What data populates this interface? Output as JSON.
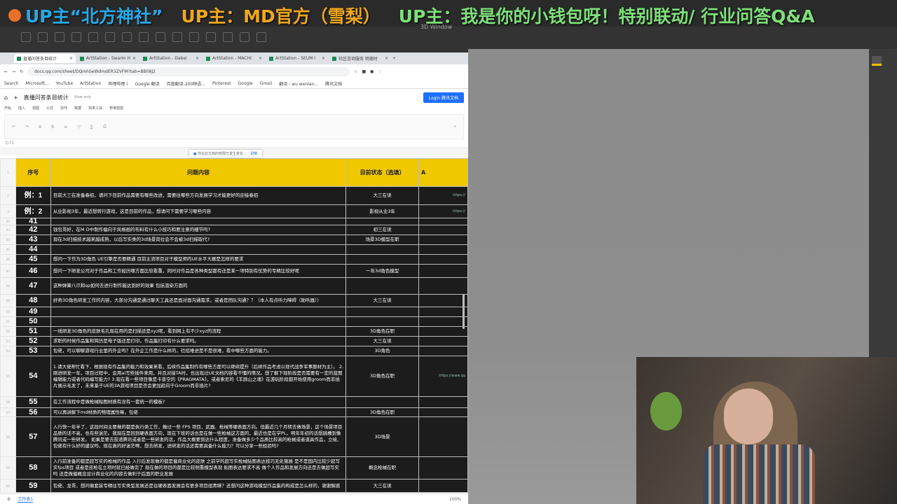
{
  "banner": {
    "part1": "UP主“北方神社”",
    "part2": "UP主：MD官方（雪梨）",
    "part3": "UP主：我是你的小钱包呀！特别联动/ 行业问答Q&A"
  },
  "app": {
    "window_label": "3D Window"
  },
  "browser": {
    "tabs": [
      "直播问答条目统计",
      "ArtStation - Swarm H",
      "ArtStation - Dabei",
      "ArtStation - MACHI",
      "ArtStation - SEUM I",
      "社区咨询服务 明德时"
    ],
    "url": "docs.qq.com/sheet/DQmhSeWdmdER3ZVFM?tab=BB08J2",
    "bookmarks": [
      "Search",
      "Microsoft...",
      "YouTube",
      "ArtStation",
      "哔哩哔哩 (",
      "Google 翻译",
      "百度翻译-200种语...",
      "Pinterest",
      "Google",
      "Gmail",
      "翻译 - wu wenlan...",
      "腾讯文档"
    ]
  },
  "doc": {
    "title": "直播问答条目统计",
    "view_only": "View only",
    "login": "Login 腾讯文档",
    "menu": [
      "开始",
      "插入",
      "视图",
      "公式",
      "协作",
      "数据",
      "效率工具",
      "表格智能"
    ],
    "notice": "你在此文档的权限已发生变化...",
    "notice_action": "刷新",
    "cell_ref": "D71",
    "sheet_tab": "工作表1",
    "zoom": "100%"
  },
  "table": {
    "headers": [
      "序号",
      "问题内容",
      "目前状态（选填）",
      "A"
    ],
    "rows": [
      {
        "rn": "2",
        "no": "例：1",
        "q": "目前大三在准备春招，请问下目前作品需要有哪些改进，需要往哪些方向发展学习才能更好的迎接春招",
        "s": "大三在读",
        "l": "https://"
      },
      {
        "rn": "3",
        "no": "例：2",
        "q": "从业影视3年，最近想转行游戏，这是目前的作品，想请问下需要学习哪些内容",
        "s": "影视从业3年",
        "l": "https://"
      },
      {
        "rn": "42",
        "no": "41",
        "q": "",
        "s": "",
        "l": ""
      },
      {
        "rn": "43",
        "no": "42",
        "q": "钱包哥好，在M D中制作偏向于风格画的布料有什么小技巧和要注意的细节吗?",
        "s": "初三在读",
        "l": ""
      },
      {
        "rn": "44",
        "no": "43",
        "q": "现在3d扫描技术越来越成熟，以后写实类的3d场景岗位会不会被3d扫描取代?",
        "s": "场景3D模型在职",
        "l": ""
      },
      {
        "rn": "45",
        "no": "44",
        "q": "",
        "s": "",
        "l": ""
      },
      {
        "rn": "46",
        "no": "45",
        "q": "想问一下作为3D角色 UE引擎是否要精通 目前主流项目对于模型师的UE水平大概是怎样的要求",
        "s": "",
        "l": ""
      },
      {
        "rn": "47",
        "no": "46",
        "q": "想问一下研发公司对于作品和工作经历哪方面比较看重，同时对作品是各种类型都有还是某一项特别有优势的专精比较好呢",
        "s": "一年3d角色模型",
        "l": ""
      },
      {
        "rn": "48",
        "no": "47",
        "q": "这种弹簧八爪和sp如何去进行制作能达到好的效果 包括渲染方面的",
        "s": "",
        "l": ""
      },
      {
        "rn": "49",
        "no": "48",
        "q": "好奇3D角色研发工作的内容，大部分沟通是通过聊天工具还是面对面沟通需求，或者是团队沟通？？（本人有点听力障碍（助听器））",
        "s": "大三在读",
        "l": ""
      },
      {
        "rn": "50",
        "no": "49",
        "q": "",
        "s": "",
        "l": ""
      },
      {
        "rn": "51",
        "no": "50",
        "q": "",
        "s": "",
        "l": ""
      },
      {
        "rn": "52",
        "no": "51",
        "q": "一线研发3D角色的皮肤毛孔现在用的是扫描还是xyz呢，看到网上有不少xyz的流程",
        "s": "3D角色在职",
        "l": ""
      },
      {
        "rn": "53",
        "no": "52",
        "q": "求职的时候作品集和简历是电子版还是打印，作品集打印有什么要求吗。",
        "s": "大三在读",
        "l": ""
      },
      {
        "rn": "54",
        "no": "53",
        "q": "包佬，可以聊聊游戏行业里的外企吗？在外企工作是什么样的，社招难进是不是很难，看中哪些方面的能力。",
        "s": "3D角色",
        "l": ""
      },
      {
        "rn": "55",
        "no": "54",
        "q": "1.请大佬帮忙看下，根据现有作品集的能力和效果来看，后续作品集制作有哪些方面可以继续提升（后续作品考虑以现代战争军事题材为主）。 2.刚进研发一年，项目过程中，会用ai写些插件来用，并且对接TA时，也出现过UE文档内容看不懂的情况。想了解下现阶段是否需要有一定的蓝图编辑能力或者代码编写能力? 3.现在看一些项目像是卡普空的《PRAGMATA》，或者索尼的《羊蹄山之魂》在游玩阶段都开始使用groom而非插片展示毛发了，未来基于UE的3A游戏项目是否会更加趋向于Groom而非插片?",
        "s": "3D角色在职",
        "l": "https://www.qq"
      },
      {
        "rn": "56",
        "no": "55",
        "q": "在工作流程中是做枪械贴图材质有没有一套统一的模板?",
        "s": "",
        "l": ""
      },
      {
        "rn": "57",
        "no": "56",
        "q": "可以再讲解下md材质的物理属性嘛，包佬",
        "s": "3D角色在职",
        "l": ""
      },
      {
        "rn": "58",
        "no": "57",
        "q": "入行快一年半了，这段时间主要做的都是执行类工作，做过一些 FPS 项目，武器、枪械等硬表面方向。但最近几个月转去做场景，这个场景项目品质的话不高，也有些迷茫。我现在是回到硬表面方向，现在下班的话也是在做一些枪械这方面的，最近也是在学PL，明年年初的话想跳槽到像腾讯或一些研发。 如果是要去投递腾讯或者是一些研发的话，作品大概要到达什么程度，准备做多少个品质比较高的枪械或者道具作品，立绘、包佬有什么好的建议吗，现在真的好迷茫啊，想去研发，进研发的话还需要具备什么能力？可以分享一些经验吗?",
        "s": "3D场景",
        "l": ""
      },
      {
        "rn": "59",
        "no": "58",
        "q": "入行前准备的都是超写实的枪械的作品 入行后发现做的都是偏商业化的皮肤 之前学的超写实枪械贴图表达技巧无处施展 是不是国内比较少超写实fps项目 或者是皮枪在立项时就已经做完了 现在做的项目的都是比较侧重模型表现 贴图表达要求不高 做个人作品和发展方向还是去做超写实吗 还是做偏概念设计商业化的内容去做利于后面的职业发展",
        "s": "概念枪械在职",
        "l": ""
      },
      {
        "rn": "60",
        "no": "59",
        "q": "包佬、龙哥，想问做套装专精往写实类型发展还是往硬表面发展会有更多项目组青睐？还想问这种游戏模型作品集的构成是怎么样的，谢谢解惑",
        "s": "大三在读",
        "l": ""
      }
    ]
  }
}
